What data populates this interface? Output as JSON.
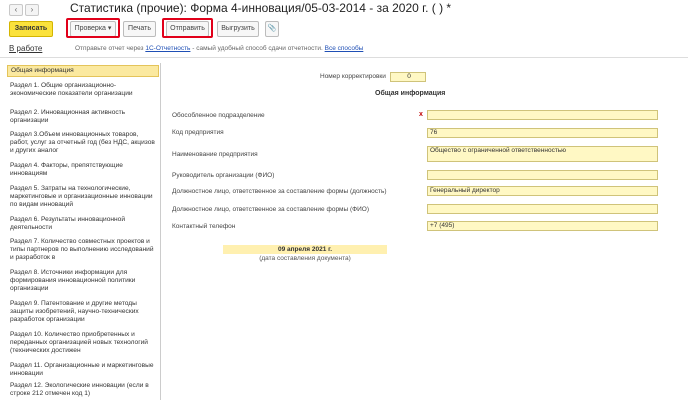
{
  "title": "Статистика (прочие): Форма 4-инновация/05-03-2014 - за 2020 г. (                              ) *",
  "nav": {
    "back_icon": "‹",
    "forward_icon": "›"
  },
  "toolbar": {
    "save": "Записать",
    "check": "Проверка",
    "print": "Печать",
    "send": "Отправить",
    "export": "Выгрузить",
    "attach_icon": "📎"
  },
  "info": {
    "tab": "В работе",
    "text_prefix": "Отправьте отчет через ",
    "link1": "1С-Отчетность",
    "text_mid": " - самый удобный способ сдачи отчетности. ",
    "link2": "Все способы"
  },
  "sidebar": {
    "items": [
      {
        "label": "Общая информация"
      },
      {
        "label": "Раздел 1. Общие организационно-экономические показатели организации"
      },
      {
        "label": "Раздел 2. Инновационная активность организации"
      },
      {
        "label": "Раздел 3.Объем инновационных товаров, работ, услуг за отчетный год (без НДС, акцизов и других аналог"
      },
      {
        "label": "Раздел 4. Факторы, препятствующие инновациям"
      },
      {
        "label": "Раздел 5. Затраты на технологические, маркетинговые и организационные инновации по видам инноваций"
      },
      {
        "label": "Раздел 6. Результаты инновационной деятельности"
      },
      {
        "label": "Раздел 7. Количество совместных проектов и типы партнеров по выполнению исследований и разработок в"
      },
      {
        "label": "Раздел 8. Источники информации для формирования инновационной политики организации"
      },
      {
        "label": "Раздел 9. Патентование и другие методы защиты изобретений, научно-технических разработок организации"
      },
      {
        "label": "Раздел 10. Количество приобретенных и переданных организацией новых технологий (технических достижен"
      },
      {
        "label": "Раздел 11. Организационные и маркетинговые инновации"
      },
      {
        "label": "Раздел 12. Экологические инновации (если в строке 212 отмечен код 1)"
      }
    ]
  },
  "form": {
    "correction_label": "Номер корректировки",
    "correction_value": "0",
    "section_title": "Общая информация",
    "fields": [
      {
        "label": "Обособленное подразделение",
        "value": ""
      },
      {
        "label": "Код предприятия",
        "value": "76"
      },
      {
        "label": "Наименование предприятия",
        "value": "Общество с ограниченной ответственностью"
      },
      {
        "label": "Руководитель организации (ФИО)",
        "value": ""
      },
      {
        "label": "Должностное лицо, ответственное за составление формы (должность)",
        "value": "Генеральный директор"
      },
      {
        "label": "Должностное лицо, ответственное за составление формы (ФИО)",
        "value": ""
      },
      {
        "label": "Контактный телефон",
        "value": "+7 (495)"
      }
    ],
    "required_mark": "x",
    "date_value": "09 апреля 2021 г.",
    "date_caption": "(дата составления документа)"
  },
  "colors": {
    "primary_button": "#fbe23c",
    "highlight_frame": "#e1001a",
    "field_bg": "#fff8c4",
    "active_item_bg": "#fbe9a0",
    "link": "#1f4fb5"
  }
}
